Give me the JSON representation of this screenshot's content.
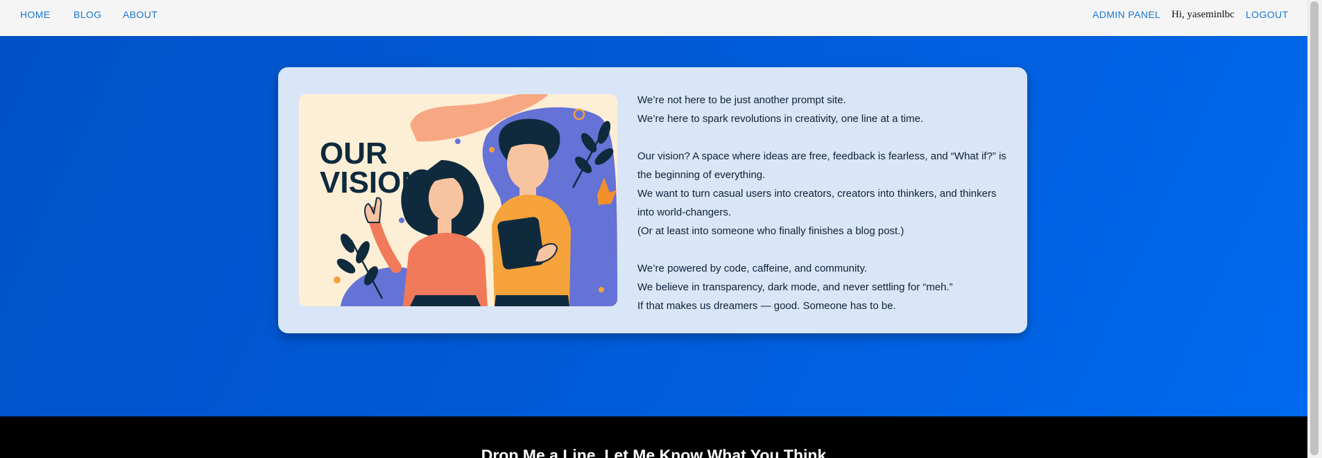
{
  "nav": {
    "home": "HOME",
    "blog": "BLOG",
    "about": "ABOUT",
    "admin_panel": "ADMIN PANEL",
    "greeting": "Hi, yaseminlbc",
    "logout": "LOGOUT"
  },
  "hero": {
    "illustration_title_line1": "OUR",
    "illustration_title_line2": "VISION",
    "paragraphs": {
      "p1": [
        "We’re not here to be just another prompt site.",
        "We’re here to spark revolutions in creativity, one line at a time."
      ],
      "p2": [
        "Our vision? A space where ideas are free, feedback is fearless, and “What if?” is the beginning of everything.",
        "We want to turn casual users into creators, creators into thinkers, and thinkers into world-changers.",
        "(Or at least into someone who finally finishes a blog post.)"
      ],
      "p3": [
        "We’re powered by code, caffeine, and community.",
        "We believe in transparency, dark mode, and never settling for “meh.”",
        "If that makes us dreamers — good. Someone has to be."
      ]
    }
  },
  "footer": {
    "title": "Drop Me a Line, Let Me Know What You Think"
  },
  "colors": {
    "nav_background": "#f5f5f5",
    "nav_link": "#1976d2",
    "hero_gradient_start": "#0052c9",
    "hero_gradient_end": "#0069ee",
    "card_background": "#d9e6f7",
    "footer_background": "#000000"
  }
}
